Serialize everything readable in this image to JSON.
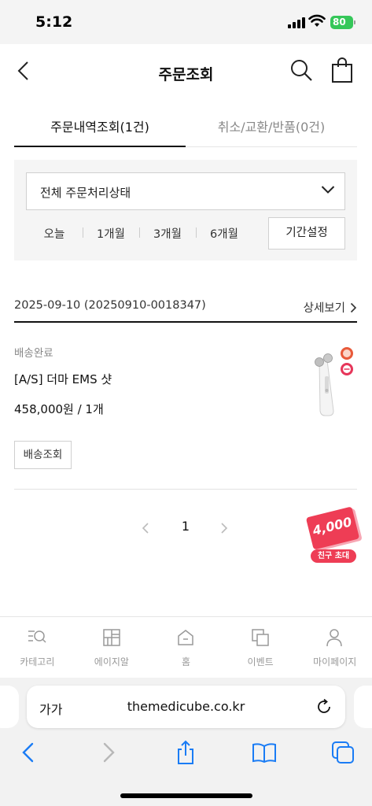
{
  "status_bar": {
    "time": "5:12",
    "battery": "80"
  },
  "header": {
    "title": "주문조회",
    "icons": [
      "back-icon",
      "search-icon",
      "shopping-bag-icon"
    ]
  },
  "tabs": [
    {
      "label": "주문내역조회(1건)",
      "active": true
    },
    {
      "label": "취소/교환/반품(0건)",
      "active": false
    }
  ],
  "filter": {
    "status_select": "전체 주문처리상태",
    "periods": [
      "오늘",
      "1개월",
      "3개월",
      "6개월"
    ],
    "date_button": "기간설정"
  },
  "order": {
    "date": "2025-09-10 (20250910-0018347)",
    "detail_link": "상세보기",
    "status": "배송완료",
    "product_name": "[A/S] 더마 EMS 샷",
    "price": "458,000원 / 1개",
    "track_button": "배송조회"
  },
  "pagination": {
    "current": "1"
  },
  "coupon": {
    "amount": "4,000",
    "label": "친구 초대"
  },
  "bottom_nav": [
    {
      "label": "카테고리",
      "icon": "category-search-icon"
    },
    {
      "label": "에이지알",
      "icon": "grid-icon"
    },
    {
      "label": "홈",
      "icon": "home-icon"
    },
    {
      "label": "이벤트",
      "icon": "event-icon"
    },
    {
      "label": "마이페이지",
      "icon": "person-icon"
    }
  ],
  "browser": {
    "text_size": "가가",
    "url": "themedicube.co.kr"
  },
  "colors": {
    "accent": "#ee3d55",
    "safari_blue": "#1a7cf5",
    "battery": "#35c759"
  }
}
